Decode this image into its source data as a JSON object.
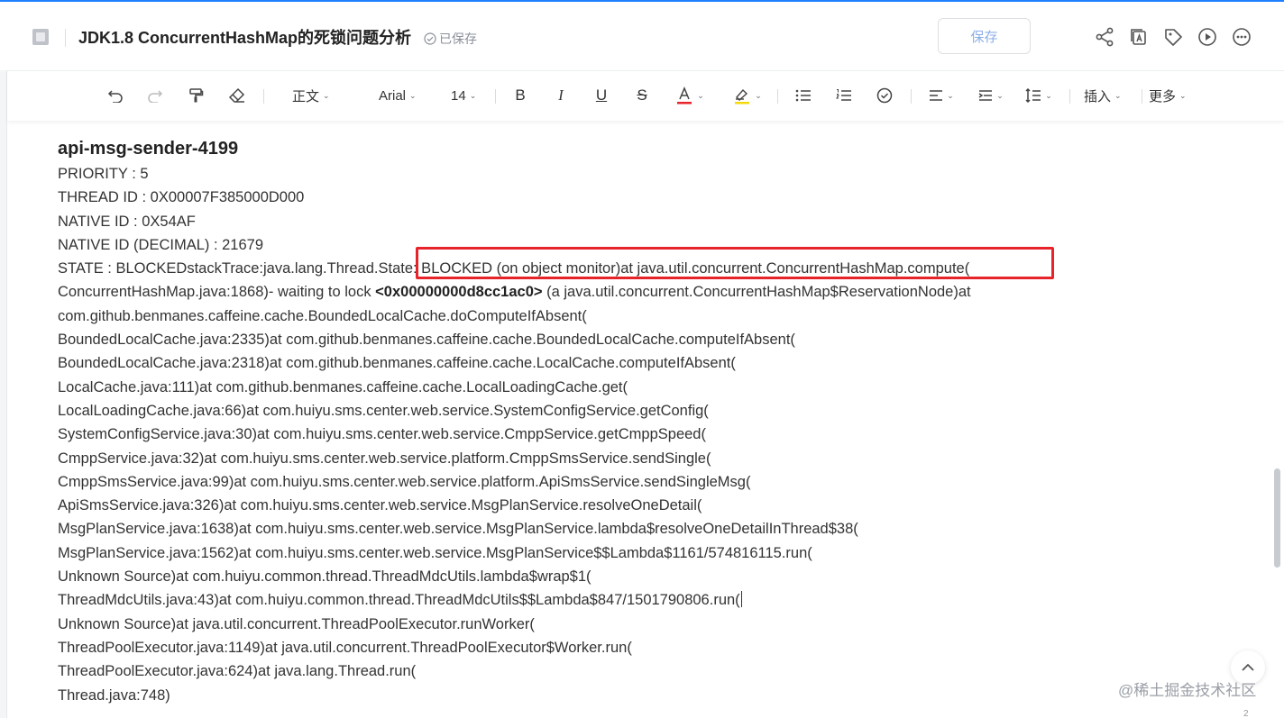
{
  "header": {
    "title": "JDK1.8 ConcurrentHashMap的死锁问题分析",
    "saved_status": "已保存",
    "save_label": "保存",
    "icons": [
      "share-icon",
      "copy-doc-icon",
      "tag-icon",
      "play-icon",
      "more-icon"
    ]
  },
  "toolbar": {
    "paragraph_style": "正文",
    "font_family": "Arial",
    "font_size": "14",
    "insert_label": "插入",
    "more_label": "更多",
    "icons": [
      "undo-icon",
      "redo-icon",
      "format-painter-icon",
      "eraser-icon",
      "bold-icon",
      "italic-icon",
      "underline-icon",
      "strikethrough-icon",
      "font-color-icon",
      "highlight-icon",
      "bullet-list-icon",
      "numbered-list-icon",
      "checklist-icon",
      "align-icon",
      "indent-icon",
      "line-height-icon"
    ],
    "font_color": "#e8242b",
    "highlight_color": "#f5d90a"
  },
  "doc": {
    "heading": "api-msg-sender-4199",
    "l1": "PRIORITY : 5",
    "l2": "THREAD ID : 0X00007F385000D000",
    "l3": "NATIVE ID : 0X54AF",
    "l4": "NATIVE ID (DECIMAL) : 21679",
    "l5": "STATE : BLOCKEDstackTrace:java.lang.Thread.State: BLOCKED (on object monitor)at java.util.concurrent.ConcurrentHashMap.compute(",
    "l6a": "ConcurrentHashMap.java:1868)- waiting to lock ",
    "l6b": "<0x00000000d8cc1ac0>",
    "l6c": " (a java.util.concurrent.ConcurrentHashMap$ReservationNode)at",
    "l7": "com.github.benmanes.caffeine.cache.BoundedLocalCache.doComputeIfAbsent(",
    "l8": "BoundedLocalCache.java:2335)at com.github.benmanes.caffeine.cache.BoundedLocalCache.computeIfAbsent(",
    "l9": "BoundedLocalCache.java:2318)at com.github.benmanes.caffeine.cache.LocalCache.computeIfAbsent(",
    "l10": "LocalCache.java:111)at com.github.benmanes.caffeine.cache.LocalLoadingCache.get(",
    "l11": "LocalLoadingCache.java:66)at com.huiyu.sms.center.web.service.SystemConfigService.getConfig(",
    "l12": "SystemConfigService.java:30)at com.huiyu.sms.center.web.service.CmppService.getCmppSpeed(",
    "l13": "CmppService.java:32)at com.huiyu.sms.center.web.service.platform.CmppSmsService.sendSingle(",
    "l14": "CmppSmsService.java:99)at com.huiyu.sms.center.web.service.platform.ApiSmsService.sendSingleMsg(",
    "l15": "ApiSmsService.java:326)at com.huiyu.sms.center.web.service.MsgPlanService.resolveOneDetail(",
    "l16": "MsgPlanService.java:1638)at com.huiyu.sms.center.web.service.MsgPlanService.lambda$resolveOneDetailInThread$38(",
    "l17": "MsgPlanService.java:1562)at com.huiyu.sms.center.web.service.MsgPlanService$$Lambda$1161/574816115.run(",
    "l18": "Unknown Source)at com.huiyu.common.thread.ThreadMdcUtils.lambda$wrap$1(",
    "l19": "ThreadMdcUtils.java:43)at com.huiyu.common.thread.ThreadMdcUtils$$Lambda$847/1501790806.run(",
    "l20": "Unknown Source)at java.util.concurrent.ThreadPoolExecutor.runWorker(",
    "l21": "ThreadPoolExecutor.java:1149)at java.util.concurrent.ThreadPoolExecutor$Worker.run(",
    "l22": "ThreadPoolExecutor.java:624)at java.lang.Thread.run(",
    "l23": "Thread.java:748)"
  },
  "annotation_color": "#e8242b",
  "watermark": "@稀土掘金技术社区",
  "page_indicator": "2"
}
